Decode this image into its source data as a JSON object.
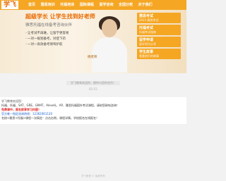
{
  "header": {
    "logo_text": "学飞",
    "nav": [
      "首页",
      "雅思培训",
      "托福培训",
      "国际课程",
      "留学咨询",
      "全国分校",
      "关于我们"
    ]
  },
  "banner": {
    "headline": "超级学长 让学生找到好老师",
    "subheadline": "雅思托福在线备考咨询伙伴",
    "bullets": [
      "- 让考试不再难，让留学更容易",
      "- 一对一规划备考，对症下药",
      "- 一对一高效备考保驾护航"
    ],
    "person_name": "杨老师",
    "side_cards": [
      {
        "title": "雅思考试",
        "sub": "2023 雅思考试"
      },
      {
        "title": "托福考试",
        "sub": "托福考试指南"
      },
      {
        "title": "留学申请",
        "sub": "留学资讯分享"
      },
      {
        "title": "学生故事",
        "sub": "看看他们的故事"
      }
    ]
  },
  "notice": {
    "title_bar": "学飞教育欢迎你，期待与您的合作！",
    "date": "02-15"
  },
  "panel": {
    "title": "学飞教育欢迎您：",
    "line1": "托福、托福、SAT、GRE、GMAT、AlevelL、AP、雅思托福国外考试课程，请给您致电咨询！",
    "line2": "免费课中，报名即享学习内容！",
    "line3": "官方唯一指定咨询热线：12362061120",
    "line4": "名校<雅思+托福>课程一次搞定：点击右侧，课程详情，学校报名在线报名！"
  },
  "footer": {
    "text": "学飞教育 © 版权所有"
  }
}
